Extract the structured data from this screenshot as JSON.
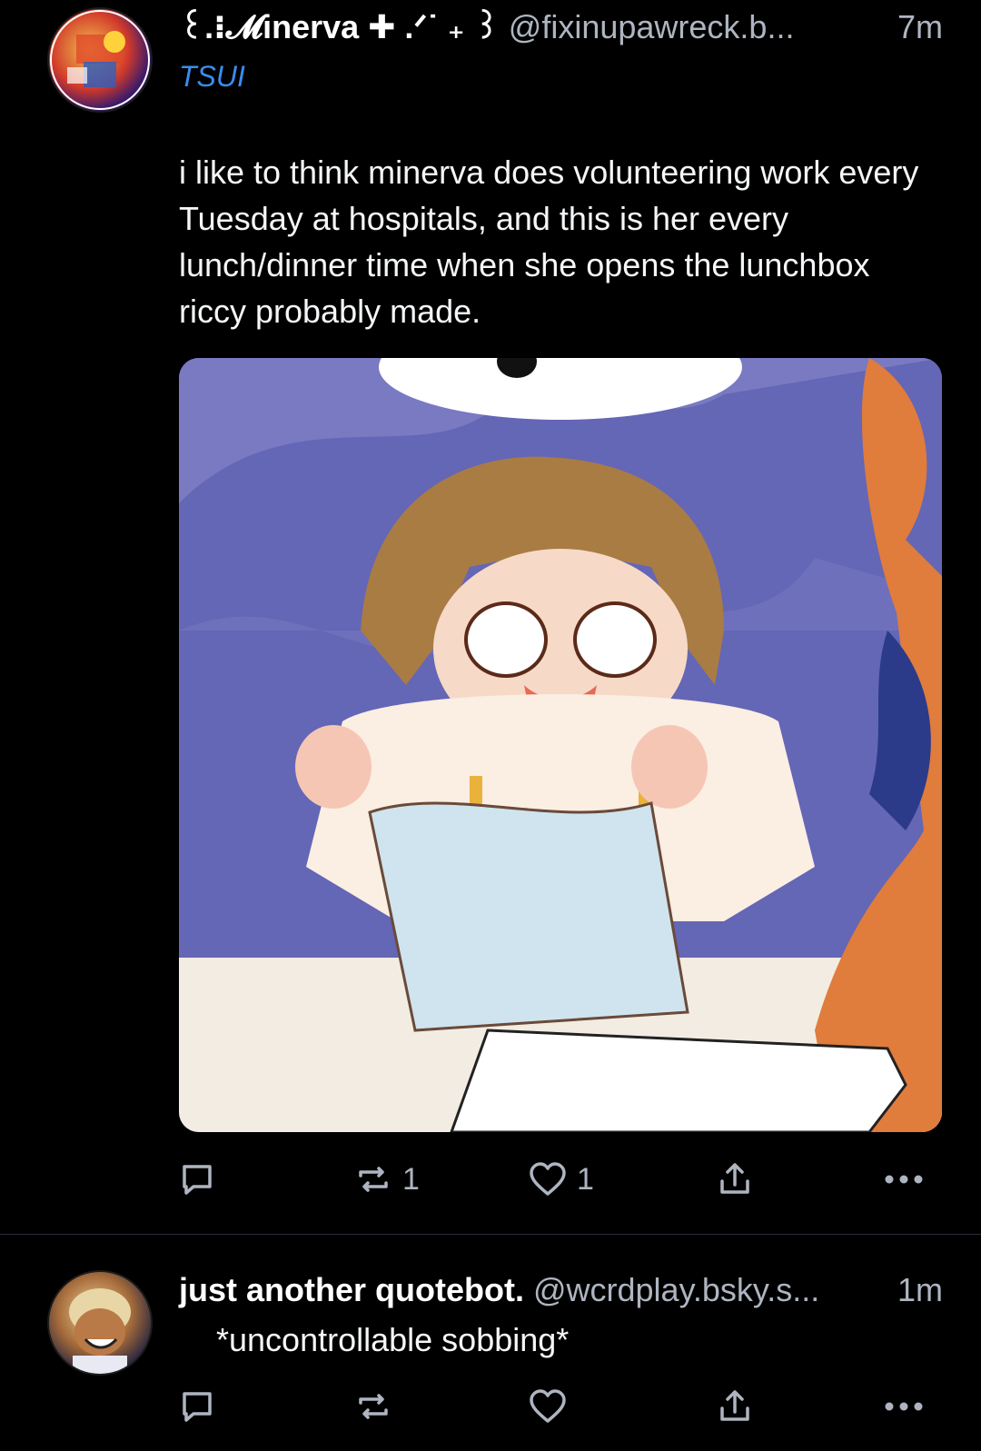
{
  "post1": {
    "author": {
      "display_name": "꒰.⁝𝓜inerva ✚ .ᐟ˙ ₊ ꒱",
      "handle": "@fixinupawreck.b...",
      "time": "7m"
    },
    "label": "TSUI",
    "text": "i like to think minerva does volunteering work every Tuesday at hospitals, and this is her every lunch/dinner time when she opens the lunchbox riccy probably made.",
    "image": {
      "description": "comic-illustration"
    },
    "actions": {
      "reply_count": "",
      "repost_count": "1",
      "like_count": "1"
    },
    "icons": {
      "reply": "reply-icon",
      "repost": "repost-icon",
      "like": "heart-icon",
      "share": "share-icon",
      "more": "more-icon"
    }
  },
  "post2": {
    "author": {
      "display_name": "just another quotebot.",
      "handle": "@wcrdplay.bsky.s...",
      "time": "1m"
    },
    "text": "*uncontrollable sobbing*",
    "actions": {
      "reply_count": "",
      "repost_count": "",
      "like_count": ""
    }
  },
  "colors": {
    "background": "#000000",
    "link": "#3a8cf0",
    "muted": "#aeb5c0"
  }
}
